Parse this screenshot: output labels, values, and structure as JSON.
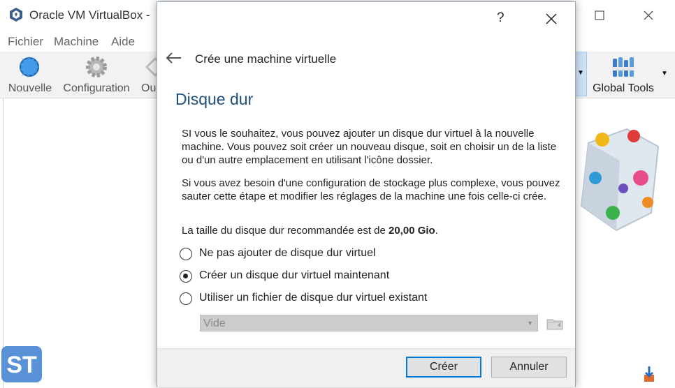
{
  "background_window": {
    "title": "Oracle VM VirtualBox -",
    "menu": [
      "Fichier",
      "Machine",
      "Aide"
    ],
    "toolbar": {
      "new_label": "Nouvelle",
      "settings_label": "Configuration",
      "partial_label": "Ou",
      "global_tools_label": "Global Tools"
    }
  },
  "dialog": {
    "help": "?",
    "close": "✕",
    "wizard_title": "Crée une machine virtuelle",
    "heading": "Disque dur",
    "paragraph1": "SI vous le souhaitez, vous pouvez ajouter un disque dur virtuel à la nouvelle machine. Vous pouvez soit créer un nouveau disque, soit en choisir un de la liste ou d'un autre emplacement en utilisant l'icône dossier.",
    "paragraph2": "Si vous avez besoin d'une configuration de stockage plus complexe, vous pouvez sauter cette étape et modifier les réglages de la machine une fois celle-ci crée.",
    "recommend_prefix": "La taille du disque dur recommandée est de ",
    "recommend_size": "20,00 Gio",
    "recommend_suffix": ".",
    "options": [
      {
        "label": "Ne pas ajouter de disque dur virtuel",
        "checked": false
      },
      {
        "label": "Créer un disque dur virtuel maintenant",
        "checked": true
      },
      {
        "label": "Utiliser un fichier de disque dur virtuel existant",
        "checked": false
      }
    ],
    "disk_combo_value": "Vide",
    "create_button": "Créer",
    "cancel_button": "Annuler"
  },
  "watermark": "ST",
  "colors": {
    "heading": "#1f4e79",
    "default_button_border": "#0078d7"
  }
}
